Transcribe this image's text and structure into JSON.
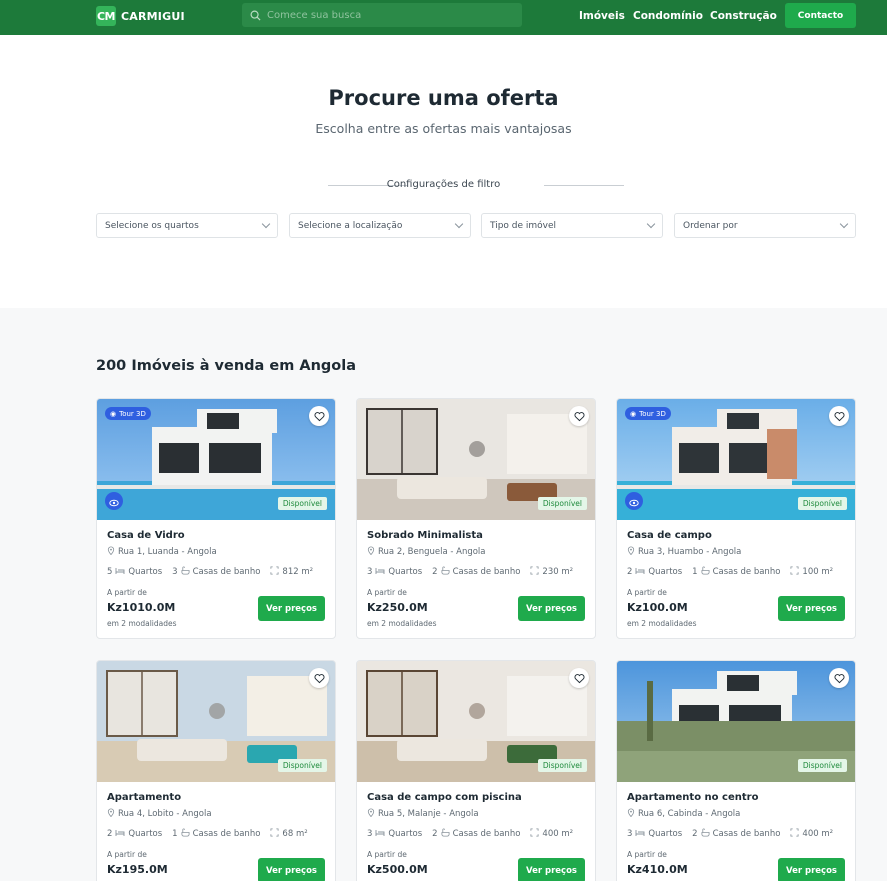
{
  "header": {
    "logo_mark": "CM",
    "logo_text": "CARMIGUI",
    "search_placeholder": "Comece sua busca",
    "nav": [
      "Imóveis",
      "Condomínio",
      "Construção"
    ],
    "contact_label": "Contacto"
  },
  "hero": {
    "title": "Procure uma oferta",
    "subtitle": "Escolha entre as ofertas mais vantajosas",
    "filter_label": "Configurações de filtro",
    "filters": [
      "Selecione os quartos",
      "Selecione a localização",
      "Tipo de imóvel",
      "Ordenar por"
    ]
  },
  "listing": {
    "title": "200 Imóveis à venda em Angola",
    "common": {
      "available": "Disponível",
      "tour": "Tour 3D",
      "from": "A partir de",
      "modes": "em 2 modalidades",
      "button": "Ver preços",
      "rooms_label": "Quartos",
      "baths_label": "Casas de banho"
    },
    "properties": [
      {
        "name": "Casa de Vidro",
        "address": "Rua 1, Luanda - Angola",
        "rooms": "5",
        "baths": "3",
        "area": "812 m²",
        "price": "Kz1010.0M",
        "tour": true
      },
      {
        "name": "Sobrado Minimalista",
        "address": "Rua 2, Benguela - Angola",
        "rooms": "3",
        "baths": "2",
        "area": "230 m²",
        "price": "Kz250.0M",
        "tour": false
      },
      {
        "name": "Casa de campo",
        "address": "Rua 3, Huambo - Angola",
        "rooms": "2",
        "baths": "1",
        "area": "100 m²",
        "price": "Kz100.0M",
        "tour": true
      },
      {
        "name": "Apartamento",
        "address": "Rua 4, Lobito - Angola",
        "rooms": "2",
        "baths": "1",
        "area": "68 m²",
        "price": "Kz195.0M",
        "tour": false
      },
      {
        "name": "Casa de campo com piscina",
        "address": "Rua 5, Malanje - Angola",
        "rooms": "3",
        "baths": "2",
        "area": "400 m²",
        "price": "Kz500.0M",
        "tour": false
      },
      {
        "name": "Apartamento no centro",
        "address": "Rua 6, Cabinda - Angola",
        "rooms": "3",
        "baths": "2",
        "area": "400 m²",
        "price": "Kz410.0M",
        "tour": false
      }
    ]
  },
  "colors": {
    "brand": "#1d7a3a",
    "button": "#1faa4c",
    "tour": "#2f5fe0",
    "available_bg": "#e4f6e8"
  }
}
